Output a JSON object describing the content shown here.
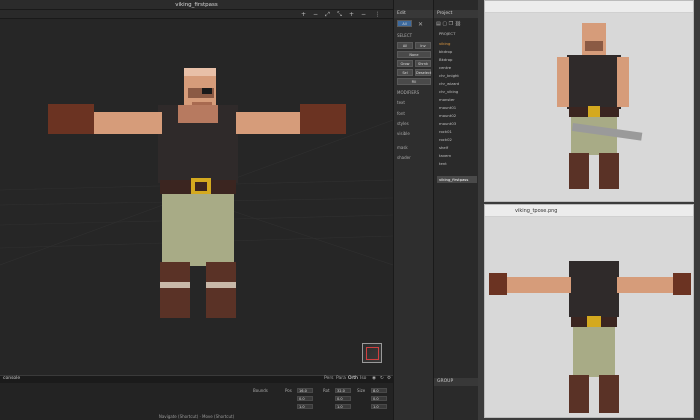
{
  "viewport": {
    "title": "viking_firstpass",
    "console_label": "console",
    "view_modes": [
      "Pers",
      "Para",
      "Orth",
      "Iso"
    ],
    "status": "Navigate (Shortcut) · Move (Shortcut)",
    "props": {
      "label_1": "Bounds",
      "label_2": "Pos",
      "label_3": "Rot",
      "label_4": "Size",
      "values": [
        "16.0",
        "32.0",
        "8.0",
        "0.0",
        "0.0",
        "0.0",
        "1.0",
        "1.0",
        "1.0"
      ]
    }
  },
  "edit_panel": {
    "header": "Edit",
    "tab_all": "All",
    "section_select": "SELECT",
    "buttons": [
      "All",
      "Inv",
      "None",
      "Grow",
      "Shrnk",
      "Sel",
      "Deselect",
      "Fill"
    ],
    "sections": [
      "MODIFIERS",
      "text",
      "font",
      "styles",
      "visible",
      "mask",
      "shader"
    ]
  },
  "project": {
    "header": "Project",
    "section": "PROJECT",
    "items": [
      "viking",
      "bkdrop",
      "Bkdrop",
      "centre",
      "chr_knight",
      "chr_wizard",
      "chr_viking",
      "monster",
      "mount01",
      "mount02",
      "mount03",
      "rock01",
      "rock02",
      "shelf",
      "tavern",
      "tent",
      "viking_firstpass"
    ],
    "selected": "viking_firstpass",
    "footer": "GROUP"
  },
  "viewer_top": {
    "title": ""
  },
  "viewer_bottom": {
    "title": "viking_tpose.png"
  },
  "colors": {
    "skin": "#d69c7a",
    "shirt": "#2f2a2a",
    "pants": "#a8ab86",
    "boots": "#5a3226",
    "gloves": "#6b3322",
    "belt": "#d4a91f"
  }
}
